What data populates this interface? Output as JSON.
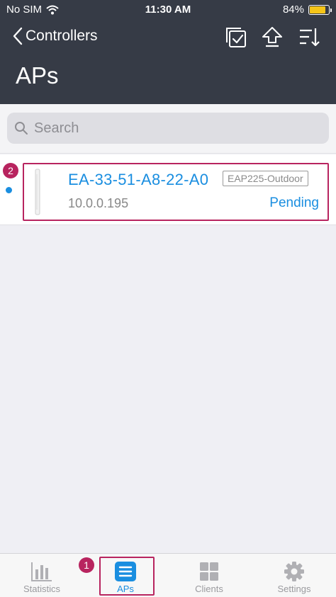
{
  "status_bar": {
    "carrier": "No SIM",
    "time": "11:30 AM",
    "battery": "84%",
    "battery_level": 0.84
  },
  "nav": {
    "back_label": "Controllers",
    "title": "APs"
  },
  "search": {
    "placeholder": "Search"
  },
  "ap_list": [
    {
      "name": "EA-33-51-A8-22-A0",
      "model": "EAP225-Outdoor",
      "ip": "10.0.0.195",
      "status": "Pending"
    }
  ],
  "annotations": {
    "badge_1": "1",
    "badge_2": "2"
  },
  "tabs": [
    {
      "label": "Statistics",
      "icon": "bar-chart-icon"
    },
    {
      "label": "APs",
      "icon": "list-icon",
      "active": true
    },
    {
      "label": "Clients",
      "icon": "grid-icon"
    },
    {
      "label": "Settings",
      "icon": "gear-icon"
    }
  ],
  "colors": {
    "header_bg": "#363b46",
    "accent": "#1a8ee0",
    "annotation": "#b8245f",
    "battery_fill": "#f5c518"
  }
}
